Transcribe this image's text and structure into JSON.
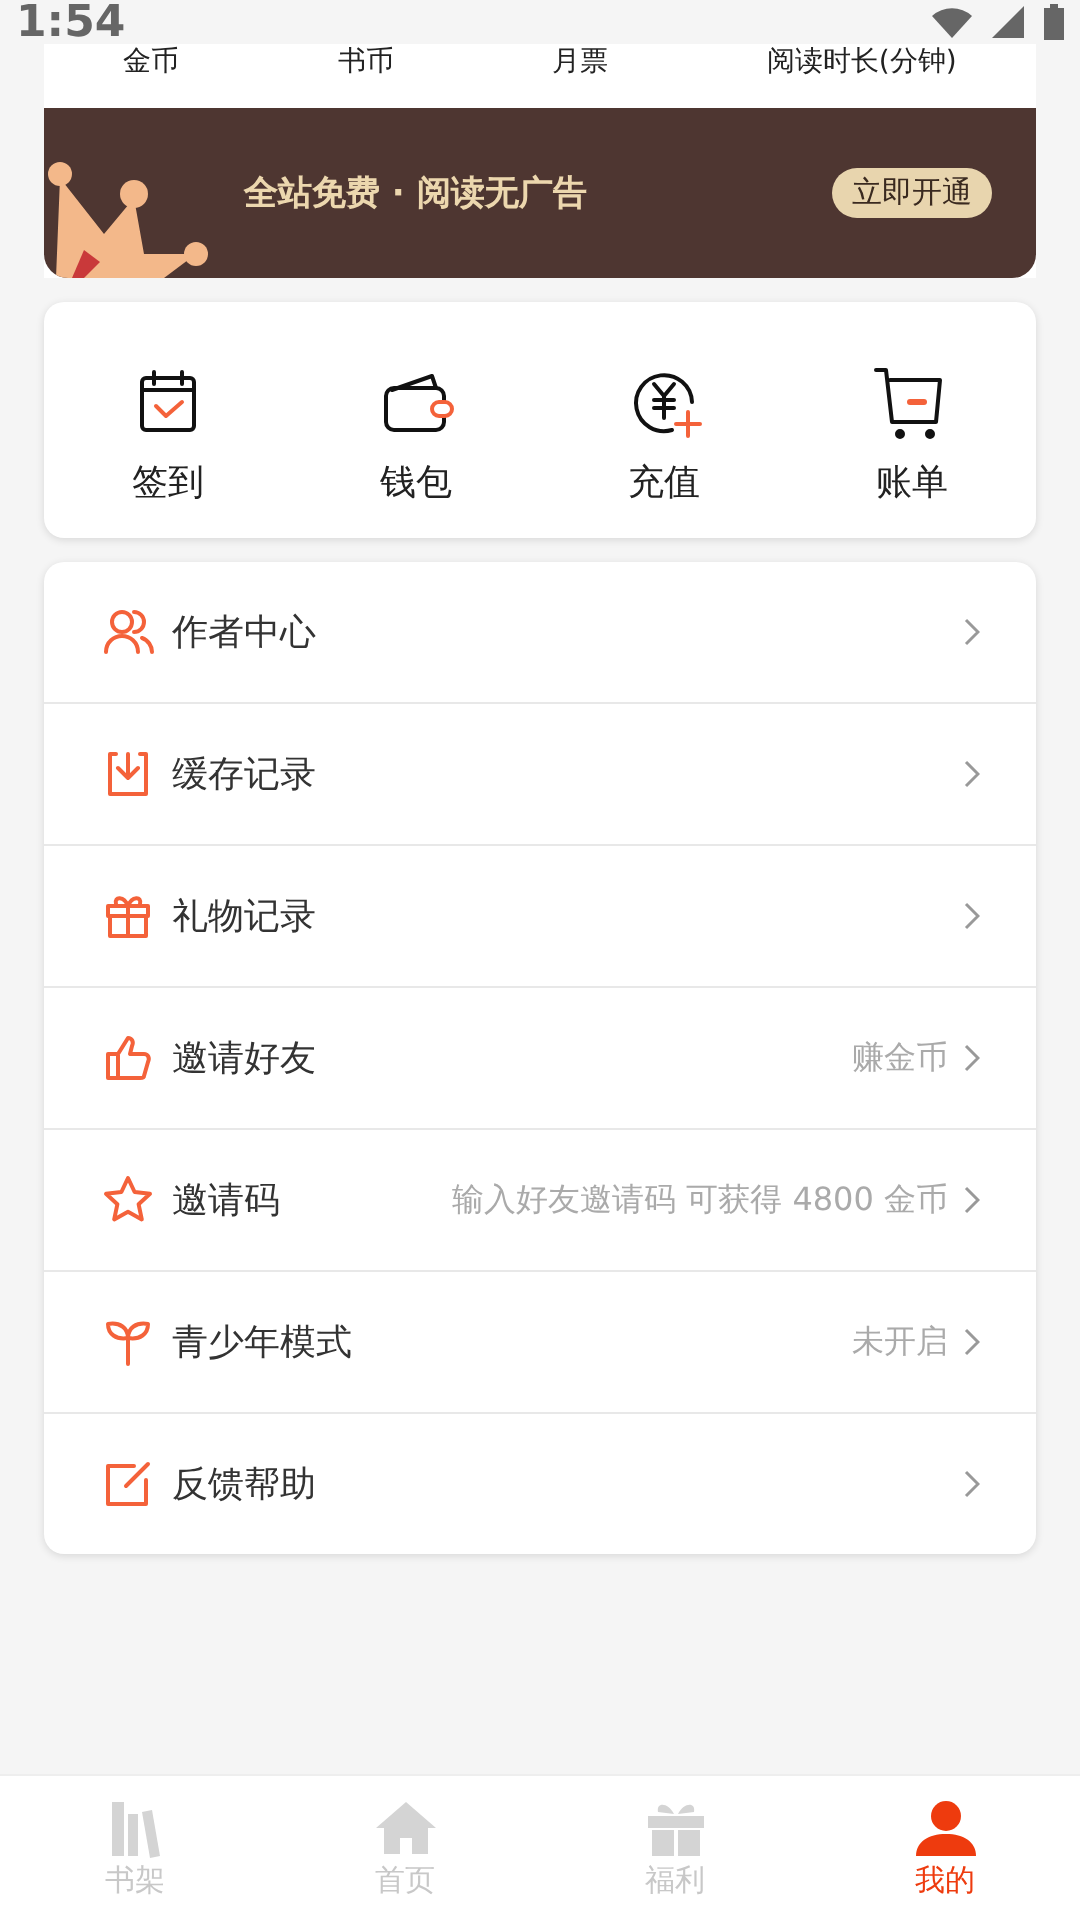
{
  "status_bar": {
    "time": "1:54"
  },
  "stats": [
    {
      "label": "金币"
    },
    {
      "label": "书币"
    },
    {
      "label": "月票"
    },
    {
      "label": "阅读时长(分钟)"
    }
  ],
  "vip_banner": {
    "text": "全站免费 · 阅读无广告",
    "button": "立即开通"
  },
  "quick_actions": [
    {
      "kind": "checkin",
      "label": "签到"
    },
    {
      "kind": "wallet",
      "label": "钱包"
    },
    {
      "kind": "recharge",
      "label": "充值"
    },
    {
      "kind": "bill",
      "label": "账单"
    }
  ],
  "menu": [
    {
      "kind": "author",
      "label": "作者中心"
    },
    {
      "kind": "cache",
      "label": "缓存记录"
    },
    {
      "kind": "gift",
      "label": "礼物记录"
    },
    {
      "kind": "invite",
      "label": "邀请好友",
      "hint": "赚金币"
    },
    {
      "kind": "code",
      "label": "邀请码",
      "hint": "输入好友邀请码 可获得 4800 金币"
    },
    {
      "kind": "teen",
      "label": "青少年模式",
      "hint": "未开启"
    },
    {
      "kind": "feedback",
      "label": "反馈帮助"
    }
  ],
  "bottom_nav": [
    {
      "kind": "shelf",
      "label": "书架",
      "selected": false
    },
    {
      "kind": "home",
      "label": "首页",
      "selected": false
    },
    {
      "kind": "welfare",
      "label": "福利",
      "selected": false
    },
    {
      "kind": "me",
      "label": "我的",
      "selected": true
    }
  ]
}
